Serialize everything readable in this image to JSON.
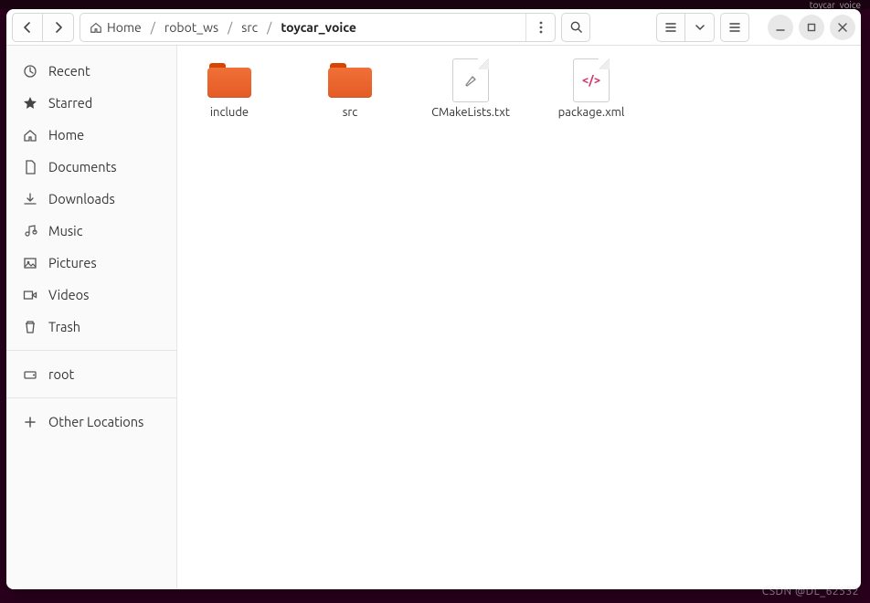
{
  "topbar_fragment": "toycar_voice",
  "watermark": "CSDN @DL_62532",
  "pathbar": {
    "home_label": "Home",
    "segments": [
      "robot_ws",
      "src"
    ],
    "current": "toycar_voice"
  },
  "sidebar": {
    "items": [
      {
        "icon": "clock-icon",
        "label": "Recent"
      },
      {
        "icon": "star-icon",
        "label": "Starred"
      },
      {
        "icon": "home-icon",
        "label": "Home"
      },
      {
        "icon": "document-icon",
        "label": "Documents"
      },
      {
        "icon": "download-icon",
        "label": "Downloads"
      },
      {
        "icon": "music-icon",
        "label": "Music"
      },
      {
        "icon": "image-icon",
        "label": "Pictures"
      },
      {
        "icon": "video-icon",
        "label": "Videos"
      },
      {
        "icon": "trash-icon",
        "label": "Trash"
      }
    ],
    "mount": {
      "icon": "drive-icon",
      "label": "root"
    },
    "other": {
      "icon": "plus-icon",
      "label": "Other Locations"
    }
  },
  "files": [
    {
      "kind": "folder",
      "name": "include",
      "label": "include"
    },
    {
      "kind": "folder",
      "name": "src",
      "label": "src"
    },
    {
      "kind": "file",
      "name": "cmakelists",
      "label": "CMakeLists.txt",
      "badge": "build"
    },
    {
      "kind": "file",
      "name": "package",
      "label": "package.xml",
      "badge": "xml"
    }
  ],
  "icons": {
    "back": "‹",
    "forward": "›"
  }
}
